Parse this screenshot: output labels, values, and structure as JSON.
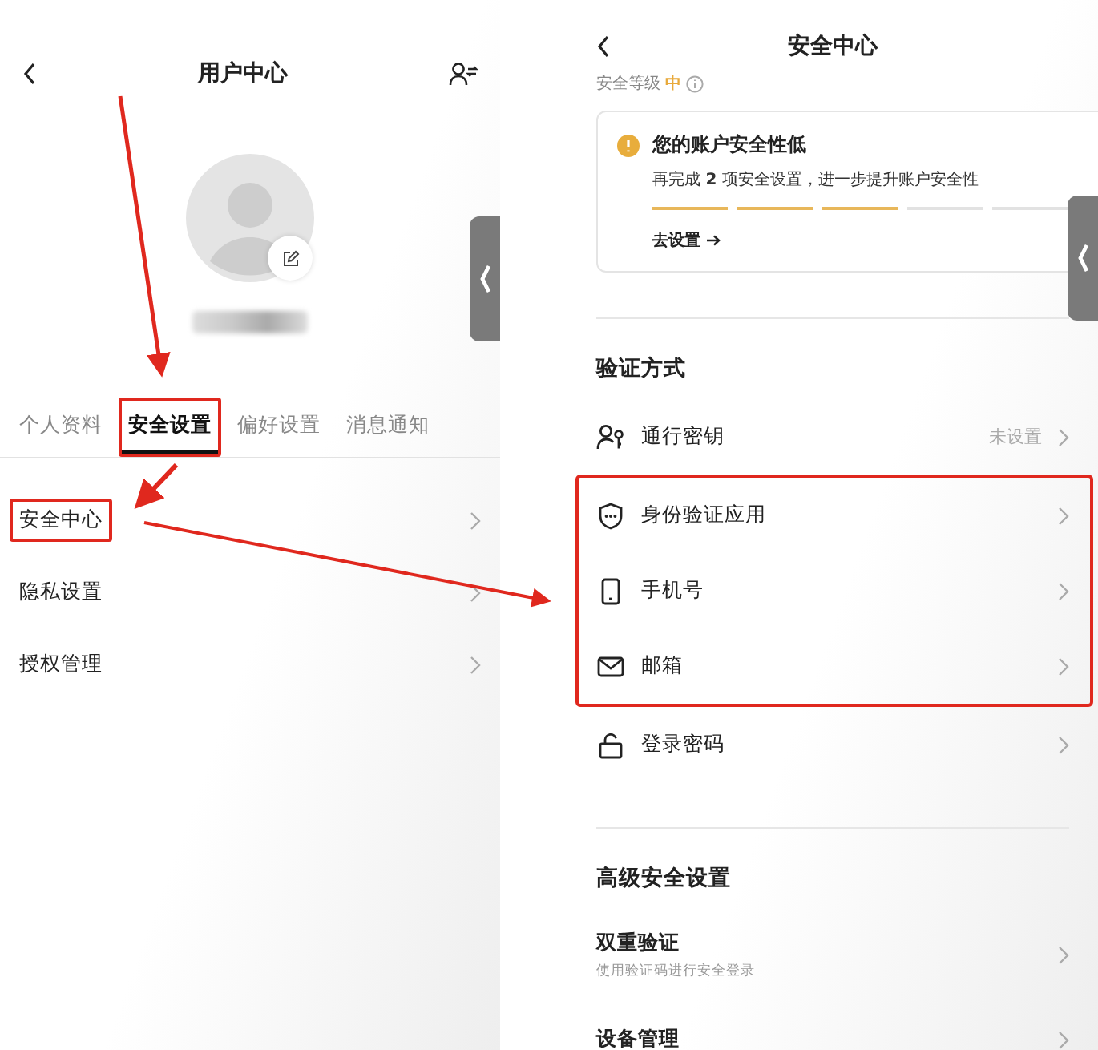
{
  "left_screen": {
    "title": "用户中心",
    "tabs": [
      {
        "label": "个人资料",
        "selected": false,
        "highlighted": false
      },
      {
        "label": "安全设置",
        "selected": true,
        "highlighted": true
      },
      {
        "label": "偏好设置",
        "selected": false,
        "highlighted": false
      },
      {
        "label": "消息通知",
        "selected": false,
        "highlighted": false
      }
    ],
    "menu": [
      {
        "label": "安全中心",
        "highlighted": true
      },
      {
        "label": "隐私设置",
        "highlighted": false
      },
      {
        "label": "授权管理",
        "highlighted": false
      }
    ]
  },
  "right_screen": {
    "title": "安全中心",
    "level_label": "安全等级",
    "level_value": "中",
    "alert": {
      "title": "您的账户安全性低",
      "message": "再完成 **2** 项安全设置，进一步提升账户安全性",
      "segments": [
        {
          "filled": true
        },
        {
          "filled": true
        },
        {
          "filled": true
        },
        {
          "filled": false
        },
        {
          "filled": false
        }
      ],
      "action": "去设置"
    },
    "sections": [
      {
        "title": "验证方式",
        "items": [
          {
            "kind": "passkey",
            "label": "通行密钥",
            "value": "未设置",
            "highlighted": false
          },
          {
            "kind": "authenticator",
            "label": "身份验证应用",
            "highlighted": true
          },
          {
            "kind": "phone",
            "label": "手机号",
            "highlighted": true
          },
          {
            "kind": "email",
            "label": "邮箱",
            "highlighted": true
          },
          {
            "kind": "password",
            "label": "登录密码",
            "highlighted": false
          }
        ]
      },
      {
        "title": "高级安全设置",
        "items": [
          {
            "kind": "plain",
            "label": "双重验证",
            "subtitle": "使用验证码进行安全登录",
            "highlighted": false
          },
          {
            "kind": "plain",
            "label": "设备管理",
            "highlighted": false
          }
        ]
      }
    ]
  }
}
